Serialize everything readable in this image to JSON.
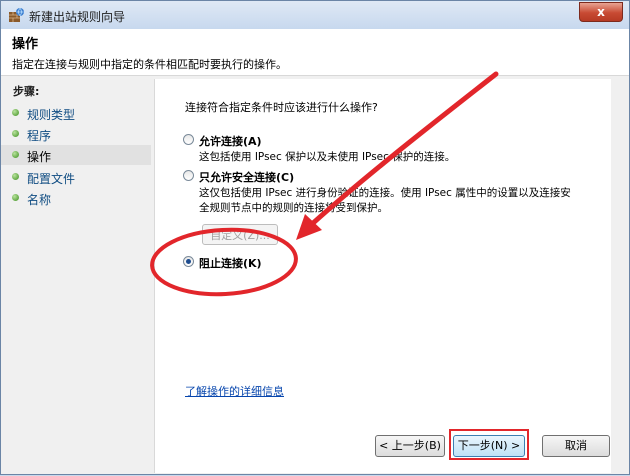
{
  "window": {
    "title": "新建出站规则向导",
    "close_glyph": "x"
  },
  "header": {
    "title": "操作",
    "description": "指定在连接与规则中指定的条件相匹配时要执行的操作。"
  },
  "sidebar": {
    "steps_label": "步骤:",
    "items": [
      {
        "label": "规则类型",
        "active": false
      },
      {
        "label": "程序",
        "active": false
      },
      {
        "label": "操作",
        "active": true
      },
      {
        "label": "配置文件",
        "active": false
      },
      {
        "label": "名称",
        "active": false
      }
    ]
  },
  "content": {
    "question": "连接符合指定条件时应该进行什么操作?",
    "options": [
      {
        "label": "允许连接(A)",
        "description": [
          "这包括使用 IPsec 保护以及未使用 IPsec 保护的连接。"
        ],
        "selected": false
      },
      {
        "label": "只允许安全连接(C)",
        "description": [
          "这仅包括使用 IPsec 进行身份验证的连接。使用 IPsec 属性中的设置以及连接安",
          "全规则节点中的规则的连接将受到保护。"
        ],
        "selected": false
      },
      {
        "label": "阻止连接(K)",
        "description": [],
        "selected": true
      }
    ],
    "customize_button": "自定义(Z)...",
    "learn_more_link": "了解操作的详细信息"
  },
  "buttons": {
    "back": "< 上一步(B)",
    "next": "下一步(N) >",
    "cancel": "取消"
  },
  "annotations": {
    "color": "#e2262b"
  }
}
